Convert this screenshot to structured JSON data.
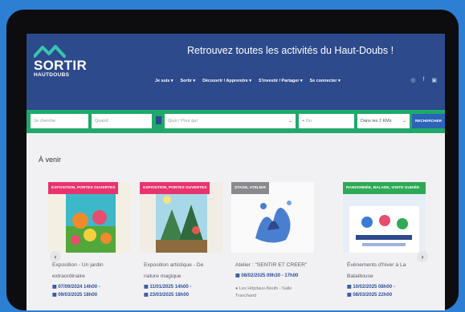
{
  "header": {
    "logo_title": "SORTIR",
    "logo_subtitle": "HAUTDOUBS",
    "headline": "Retrouvez toutes les activités du Haut-Doubs !",
    "nav": [
      "Je suis ▾",
      "Sortir ▾",
      "Découvrir / Apprendre ▾",
      "S'investir / Partager ▾",
      "Se connecter ▾"
    ],
    "social_icons": [
      "instagram-icon",
      "facebook-icon",
      "youtube-icon"
    ]
  },
  "search": {
    "what_placeholder": "Je cherche",
    "when_placeholder": "Quand",
    "for_whom_placeholder": "Quoi / Pour qui",
    "where_placeholder": "Ou",
    "radius": "Dans les 2 KMs",
    "button": "RECHERCHER"
  },
  "section_title": "À venir",
  "cards": [
    {
      "tag": "EXPOSITION, PORTES OUVERTES",
      "title_line1": "Exposition - Un jardin",
      "title_line2": "extraordinaire",
      "date1": "07/09/2024 14h00 -",
      "date2": "09/03/2025 18h00",
      "location": ""
    },
    {
      "tag": "EXPOSITION, PORTES OUVERTES",
      "title_line1": "Exposition artistique - De",
      "title_line2": "nature magique",
      "date1": "11/01/2025 14h00 -",
      "date2": "23/03/2025 18h00",
      "location": ""
    },
    {
      "tag": "STAGE, ATELIER",
      "title_line1": "Atelier : \"SENTIR ET CREER\"",
      "title_line2": "",
      "date1": "08/02/2025 09h30 - 17h00",
      "date2": "",
      "location": "Les Hôpitaux-Neufs - Salle Tranchand"
    },
    {
      "tag": "RANDONNÉE, BALADE, VISITE GUIDÉE",
      "title_line1": "Évènements d'hiver à La",
      "title_line2": "Bataillouse",
      "date1": "10/02/2025 08h00 -",
      "date2": "08/03/2025 22h00",
      "location": ""
    }
  ],
  "colors": {
    "header_bg": "#2c4a8c",
    "search_bg": "#1fa96a",
    "tag_pink": "#e8336f",
    "tag_green": "#2eaa57",
    "page_bg": "#2d7fd3"
  }
}
